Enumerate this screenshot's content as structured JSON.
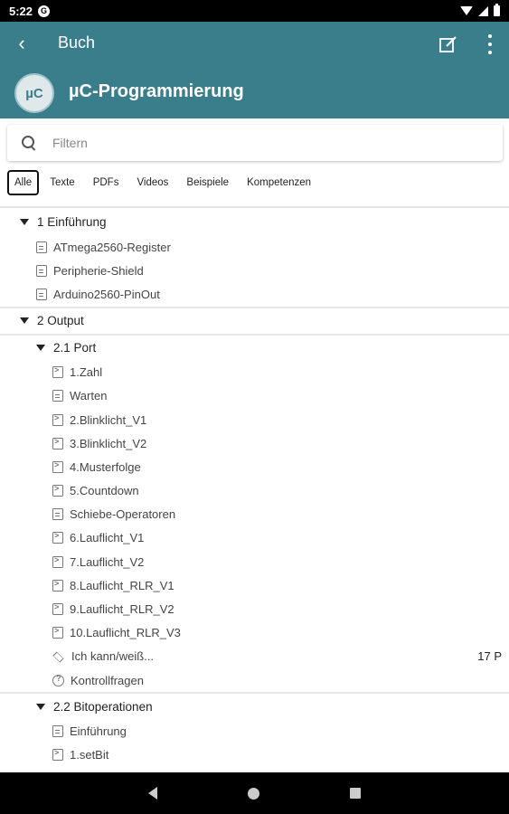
{
  "status_bar": {
    "time": "5:22",
    "g_label": "G"
  },
  "appbar": {
    "title": "Buch",
    "avatar_text": "µC",
    "course_title": "µC-Programmierung"
  },
  "search": {
    "placeholder": "Filtern"
  },
  "filters": [
    "Alle",
    "Texte",
    "PDFs",
    "Videos",
    "Beispiele",
    "Kompetenzen"
  ],
  "filter_selected": "Alle",
  "tree": [
    {
      "level": 0,
      "type": "chapter",
      "label": "1 Einführung"
    },
    {
      "level": 1,
      "type": "doc",
      "label": "ATmega2560-Register"
    },
    {
      "level": 1,
      "type": "doc",
      "label": "Peripherie-Shield"
    },
    {
      "level": 1,
      "type": "doc",
      "label": "Arduino2560-PinOut"
    },
    {
      "level": 0,
      "type": "chapter",
      "label": "2 Output",
      "separator": true
    },
    {
      "level": 1,
      "type": "chapter",
      "label": "2.1 Port",
      "separator": true
    },
    {
      "level": 2,
      "type": "code",
      "label": "1.Zahl"
    },
    {
      "level": 2,
      "type": "doc",
      "label": "Warten"
    },
    {
      "level": 2,
      "type": "code",
      "label": "2.Blinklicht_V1"
    },
    {
      "level": 2,
      "type": "code",
      "label": "3.Blinklicht_V2"
    },
    {
      "level": 2,
      "type": "code",
      "label": "4.Musterfolge"
    },
    {
      "level": 2,
      "type": "code",
      "label": "5.Countdown"
    },
    {
      "level": 2,
      "type": "doc",
      "label": "Schiebe-Operatoren"
    },
    {
      "level": 2,
      "type": "code",
      "label": "6.Lauflicht_V1"
    },
    {
      "level": 2,
      "type": "code",
      "label": "7.Lauflicht_V2"
    },
    {
      "level": 2,
      "type": "code",
      "label": "8.Lauflicht_RLR_V1"
    },
    {
      "level": 2,
      "type": "code",
      "label": "9.Lauflicht_RLR_V2"
    },
    {
      "level": 2,
      "type": "code",
      "label": "10.Lauflicht_RLR_V3"
    },
    {
      "level": 2,
      "type": "cap",
      "label": "Ich kann/weiß...",
      "points": "17 P"
    },
    {
      "level": 2,
      "type": "q",
      "label": "Kontrollfragen"
    },
    {
      "level": 1,
      "type": "chapter",
      "label": "2.2 Bitoperationen",
      "separator": true
    },
    {
      "level": 2,
      "type": "doc",
      "label": "Einführung"
    },
    {
      "level": 2,
      "type": "code",
      "label": "1.setBit"
    }
  ]
}
